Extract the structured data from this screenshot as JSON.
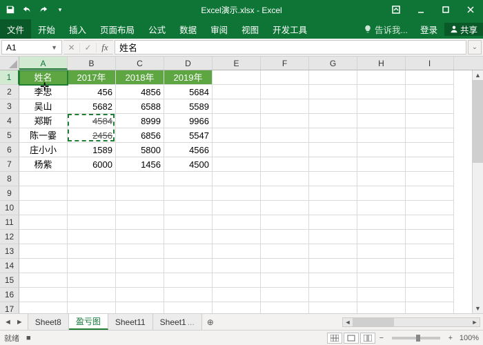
{
  "titlebar": {
    "title": "Excel演示.xlsx - Excel"
  },
  "ribbon": {
    "tabs": [
      "文件",
      "开始",
      "插入",
      "页面布局",
      "公式",
      "数据",
      "审阅",
      "视图",
      "开发工具"
    ],
    "tell_me": "告诉我...",
    "login": "登录",
    "share": "共享"
  },
  "formulabar": {
    "namebox": "A1",
    "formula": "姓名"
  },
  "columns": [
    "A",
    "B",
    "C",
    "D",
    "E",
    "F",
    "G",
    "H",
    "I"
  ],
  "rowcount": 17,
  "selected_col": 0,
  "selected_row": 0,
  "data_rows": [
    {
      "hdr": true,
      "cells": [
        "姓名",
        "2017年",
        "2018年",
        "2019年"
      ]
    },
    {
      "hdr": false,
      "cells": [
        "李忠",
        "456",
        "4856",
        "5684"
      ]
    },
    {
      "hdr": false,
      "cells": [
        "吴山",
        "5682",
        "6588",
        "5589"
      ]
    },
    {
      "hdr": false,
      "cells": [
        "郑斯",
        "4584",
        "8999",
        "9966"
      ],
      "strike_cols": [
        1
      ]
    },
    {
      "hdr": false,
      "cells": [
        "陈一霎",
        "2456",
        "6856",
        "5547"
      ],
      "strike_cols": [
        1
      ]
    },
    {
      "hdr": false,
      "cells": [
        "庄小小",
        "1589",
        "5800",
        "4566"
      ]
    },
    {
      "hdr": false,
      "cells": [
        "杨紫",
        "6000",
        "1456",
        "4500"
      ]
    }
  ],
  "marching_ants": {
    "top_row": 3,
    "left_col": 1,
    "rows": 2,
    "cols": 1
  },
  "sheets": {
    "tabs": [
      "Sheet8",
      "盈亏图",
      "Sheet11",
      "Sheet1"
    ],
    "ellipsis": "...",
    "active": 1
  },
  "status": {
    "left": "就绪",
    "macro": "■",
    "zoom": "100%"
  }
}
